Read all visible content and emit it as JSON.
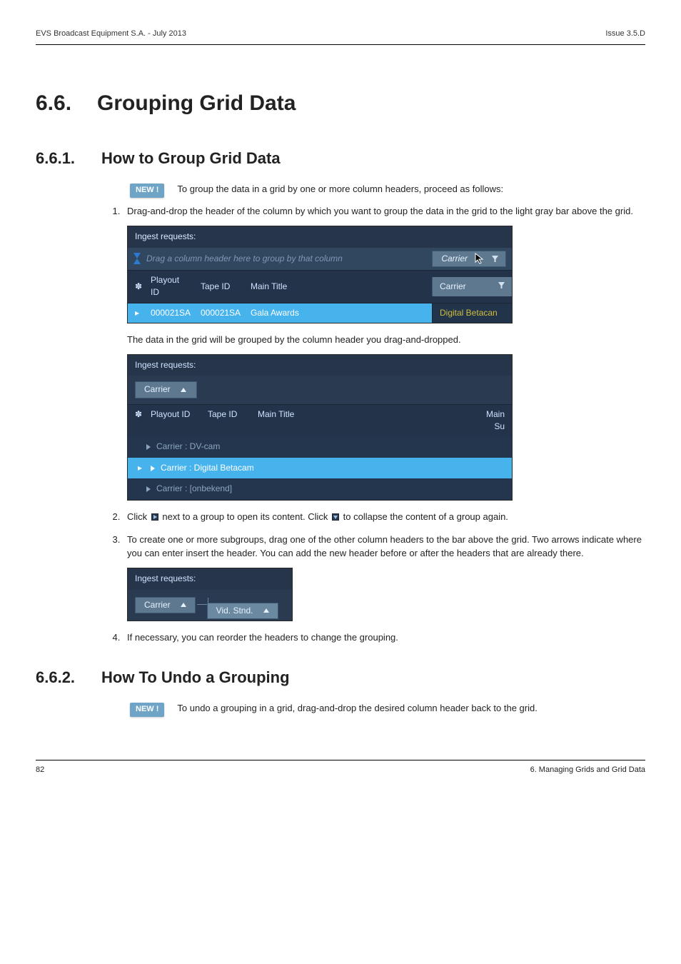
{
  "page": {
    "header_left": "EVS Broadcast Equipment S.A.  - July 2013",
    "header_right": "Issue 3.5.D",
    "footer_page": "82",
    "footer_section": "6. Managing Grids and Grid Data"
  },
  "section": {
    "num": "6.6.",
    "title": "Grouping Grid Data"
  },
  "sub1": {
    "num": "6.6.1.",
    "title": "How to Group Grid Data"
  },
  "sub2": {
    "num": "6.6.2.",
    "title": "How To Undo a Grouping"
  },
  "badge": "NEW !",
  "intro1": "To group the data in a grid by one or more column headers, proceed as follows:",
  "intro2": "To undo a grouping in a grid, drag-and-drop the desired column header back to the grid.",
  "steps": {
    "s1": "Drag-and-drop the header of the column by which you want to group the data in the grid to the light gray bar above the grid.",
    "after_shot1": "The data in the grid will be grouped by the column header you drag-and-dropped.",
    "s2_a": "Click",
    "s2_b": "next to a group to open its content. Click",
    "s2_c": "to collapse the content of a group again.",
    "s3": "To create one or more subgroups, drag one of the other column headers to the bar above the grid. Two arrows indicate where you can enter insert the header. You can add the new header before or after the headers that are already there.",
    "s4": "If necessary, you can reorder the headers to change the grouping."
  },
  "shot1": {
    "title": "Ingest requests:",
    "placeholder": "Drag a column header here to group by that column",
    "carrier_chip": "Carrier",
    "cols": {
      "playout": "Playout ID",
      "tape": "Tape ID",
      "main": "Main Title",
      "carrier_col": "Carrier"
    },
    "row": {
      "playout": "000021SA",
      "tape": "000021SA",
      "main": "Gala Awards",
      "carrier": "Digital Betacan"
    }
  },
  "shot2": {
    "title": "Ingest requests:",
    "chip": "Carrier",
    "cols": {
      "playout": "Playout ID",
      "tape": "Tape ID",
      "main": "Main Title",
      "mainsu": "Main Su"
    },
    "groups": {
      "g1": "Carrier : DV-cam",
      "g2": "Carrier : Digital Betacam",
      "g3": "Carrier : [onbekend]"
    }
  },
  "shot3": {
    "title": "Ingest requests:",
    "chip1": "Carrier",
    "chip2": "Vid. Stnd."
  }
}
